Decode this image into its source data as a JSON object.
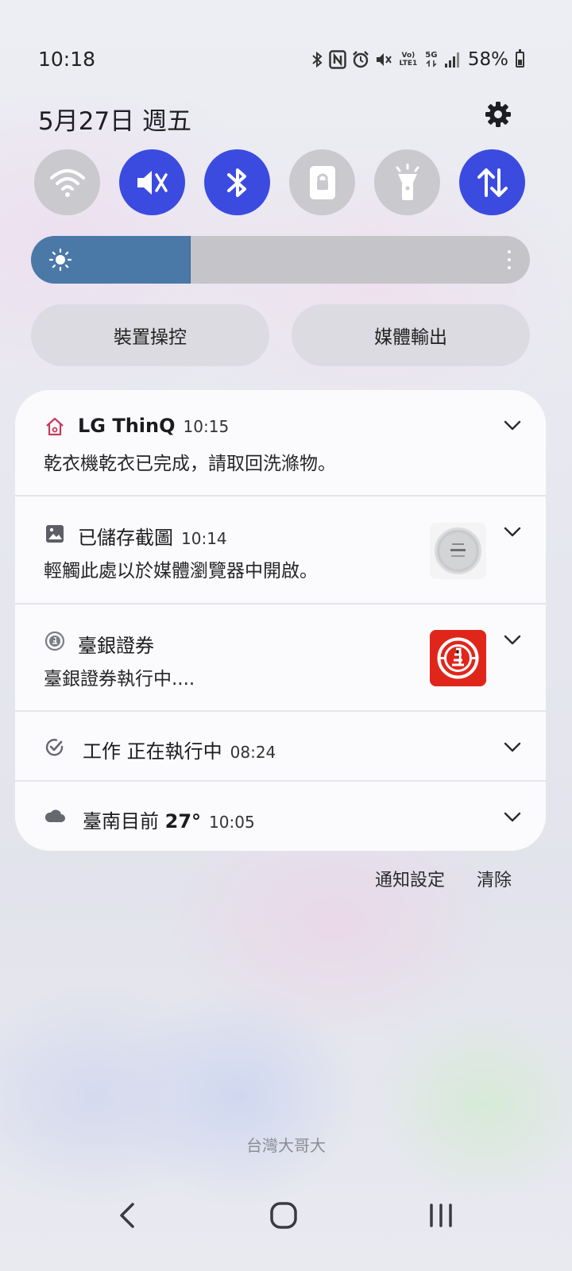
{
  "status_bar": {
    "time": "10:18",
    "volte_tag": "Vo)\nLTE1",
    "network_tag": "5G",
    "battery_percent": "58%",
    "battery_level": 0.58,
    "icons": [
      "bluetooth-icon",
      "nfc-icon",
      "alarm-icon",
      "mute-icon",
      "volte-icon",
      "5g-icon",
      "signal-icon",
      "battery-icon"
    ]
  },
  "header": {
    "date": "5月27日 週五"
  },
  "quick_toggles": [
    {
      "name": "wifi",
      "icon": "wifi-icon",
      "state": "off"
    },
    {
      "name": "sound",
      "icon": "mute-icon",
      "state": "on"
    },
    {
      "name": "bluetooth",
      "icon": "bluetooth-icon",
      "state": "on"
    },
    {
      "name": "portrait-lock",
      "icon": "rotation-lock-icon",
      "state": "off"
    },
    {
      "name": "flashlight",
      "icon": "flashlight-icon",
      "state": "off"
    },
    {
      "name": "mobile-data",
      "icon": "data-transfer-icon",
      "state": "on"
    }
  ],
  "brightness": {
    "level": 0.32
  },
  "buttons": {
    "device_control": "裝置操控",
    "media_output": "媒體輸出"
  },
  "notifications": [
    {
      "app": "LG ThinQ",
      "time": "10:15",
      "body": "乾衣機乾衣已完成，請取回洗滌物。",
      "icon": "home-icon"
    },
    {
      "app": "已儲存截圖",
      "time": "10:14",
      "body": "輕觸此處以於媒體瀏覽器中開啟。",
      "icon": "image-icon"
    },
    {
      "app": "臺銀證券",
      "time": "",
      "body": "臺銀證券執行中....",
      "icon": "bank-logo-icon"
    },
    {
      "app": "工作 正在執行中",
      "time": "08:24",
      "body": "",
      "icon": "task-check-icon"
    },
    {
      "app_prefix": "臺南目前 ",
      "app_value": "27°",
      "time": "10:05",
      "body": "",
      "icon": "cloud-icon"
    }
  ],
  "footer": {
    "settings_label": "通知設定",
    "clear_label": "清除"
  },
  "carrier": "台灣大哥大",
  "colors": {
    "accent_blue": "#3b4be0",
    "brightness_fill": "#4a79a8",
    "toggle_off": "#c9c9ce",
    "bank_red": "#e0261b",
    "home_icon_red": "#c8395a"
  }
}
